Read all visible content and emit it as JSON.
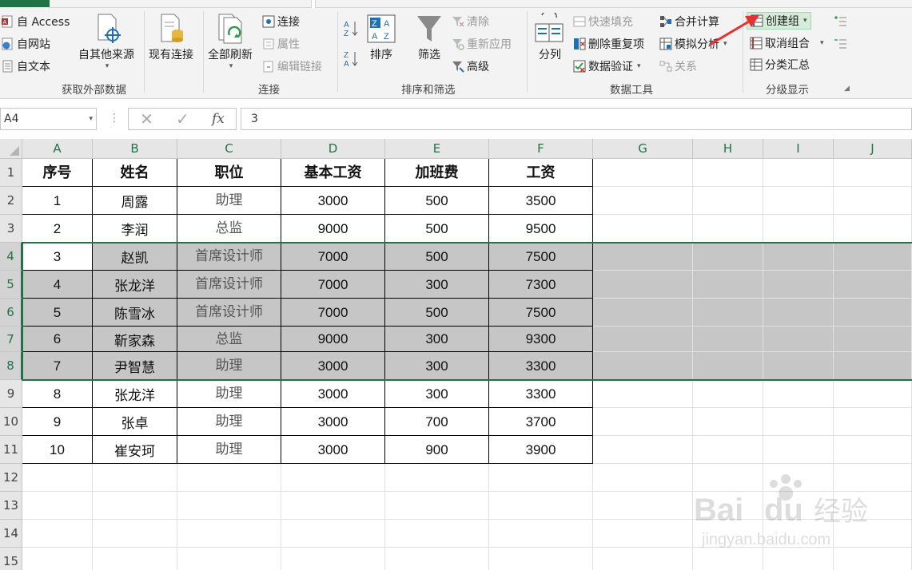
{
  "ribbon": {
    "groups": {
      "external": {
        "label": "获取外部数据",
        "access": "自 Access",
        "web": "自网站",
        "text": "自文本",
        "other_sources": "自其他来源",
        "existing": "现有连接"
      },
      "connections": {
        "label": "连接",
        "refresh_all": "全部刷新",
        "connections": "连接",
        "properties": "属性",
        "edit_links": "编辑链接"
      },
      "sort_filter": {
        "label": "排序和筛选",
        "sort": "排序",
        "filter": "筛选",
        "clear": "清除",
        "reapply": "重新应用",
        "advanced": "高级"
      },
      "data_tools": {
        "label": "数据工具",
        "text_to_columns": "分列",
        "flash_fill": "快速填充",
        "remove_duplicates": "删除重复项",
        "data_validation": "数据验证",
        "consolidate": "合并计算",
        "what_if": "模拟分析",
        "relationships": "关系"
      },
      "outline": {
        "label": "分级显示",
        "group": "创建组",
        "ungroup": "取消组合",
        "subtotal": "分类汇总"
      }
    },
    "accent": "#217346"
  },
  "formula_bar": {
    "name_box": "A4",
    "fx": "fx",
    "content": "3"
  },
  "sheet": {
    "columns": [
      "A",
      "B",
      "C",
      "D",
      "E",
      "F",
      "G",
      "H",
      "I",
      "J"
    ],
    "rows": [
      "1",
      "2",
      "3",
      "4",
      "5",
      "6",
      "7",
      "8",
      "9",
      "10",
      "11",
      "12",
      "13",
      "14",
      "15"
    ],
    "table": [
      [
        "序号",
        "姓名",
        "职位",
        "基本工资",
        "加班费",
        "工资"
      ],
      [
        "1",
        "周露",
        "助理",
        "3000",
        "500",
        "3500"
      ],
      [
        "2",
        "李润",
        "总监",
        "9000",
        "500",
        "9500"
      ],
      [
        "3",
        "赵凯",
        "首席设计师",
        "7000",
        "500",
        "7500"
      ],
      [
        "4",
        "张龙洋",
        "首席设计师",
        "7000",
        "300",
        "7300"
      ],
      [
        "5",
        "陈雪冰",
        "首席设计师",
        "7000",
        "500",
        "7500"
      ],
      [
        "6",
        "靳家森",
        "总监",
        "9000",
        "300",
        "9300"
      ],
      [
        "7",
        "尹智慧",
        "助理",
        "3000",
        "300",
        "3300"
      ],
      [
        "8",
        "张龙洋",
        "助理",
        "3000",
        "300",
        "3300"
      ],
      [
        "9",
        "张卓",
        "助理",
        "3000",
        "700",
        "3700"
      ],
      [
        "10",
        "崔安珂",
        "助理",
        "3000",
        "900",
        "3900"
      ]
    ],
    "selected_rows": [
      "4",
      "5",
      "6",
      "7",
      "8"
    ],
    "active_cell": "A4",
    "selection_fill": "#c6c6c6"
  },
  "watermark": {
    "brand": "Bai",
    "brand2": "du",
    "cn": "经验",
    "url": "jingyan.baidu.com"
  }
}
